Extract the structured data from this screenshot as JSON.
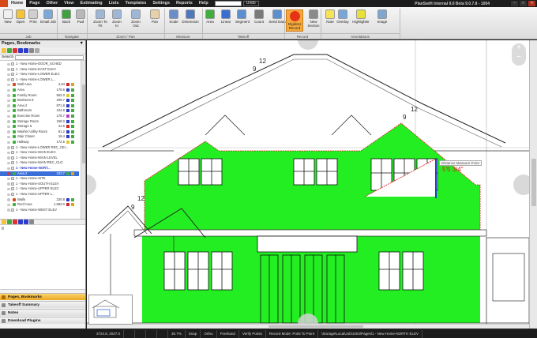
{
  "app": {
    "title": "PlanSwift Internal 9.0 Beta  9.0.7.8 - 1004",
    "menu": [
      "Home",
      "Page",
      "Other",
      "View",
      "Estimating",
      "Lists",
      "Templates",
      "Settings",
      "Reports",
      "Help"
    ],
    "search_button": "Undo",
    "window_buttons": [
      "–",
      "□",
      "✕"
    ]
  },
  "ribbon": {
    "buttons": [
      {
        "label": "New",
        "icon": "new-page-icon",
        "color": "#f0f0f0"
      },
      {
        "label": "Open",
        "icon": "folder-open-icon",
        "color": "#f3c33b"
      },
      {
        "label": "Print",
        "icon": "print-icon",
        "color": "#cfcfcf"
      },
      {
        "label": "Email Job",
        "icon": "email-icon",
        "color": "#7aa8d8"
      },
      {
        "label": "Back",
        "icon": "back-arrow-icon",
        "color": "#3fa23f"
      },
      {
        "label": "Fwd",
        "icon": "forward-arrow-icon",
        "color": "#b8b8b8"
      },
      {
        "label": "Zoom To Fit",
        "icon": "zoom-fit-icon",
        "color": "#9fb6d6"
      },
      {
        "label": "Zoom In",
        "icon": "zoom-in-icon",
        "color": "#9fb6d6"
      },
      {
        "label": "Zoom Out",
        "icon": "zoom-out-icon",
        "color": "#9fb6d6"
      },
      {
        "label": "Pan",
        "icon": "hand-pan-icon",
        "color": "#e8d0a8"
      },
      {
        "label": "Scale",
        "icon": "scale-icon",
        "color": "#6a8fc8"
      },
      {
        "label": "Dimension",
        "icon": "dimension-icon",
        "color": "#4f78bd"
      },
      {
        "label": "Area",
        "icon": "area-icon",
        "color": "#3fae3f"
      },
      {
        "label": "Linear",
        "icon": "linear-icon",
        "color": "#3a6fd0"
      },
      {
        "label": "Segment",
        "icon": "segment-icon",
        "color": "#5b8fd0"
      },
      {
        "label": "Count",
        "icon": "count-icon",
        "color": "#7a7a7a"
      },
      {
        "label": "Send Data",
        "icon": "send-data-icon",
        "color": "#5b8fd0"
      },
      {
        "label": "Digitizer Record",
        "icon": "record-icon",
        "color": "#e63217"
      },
      {
        "label": "New Section",
        "icon": "new-section-icon",
        "color": "#8a8a8a"
      },
      {
        "label": "Note",
        "icon": "note-icon",
        "color": "#f5e35a"
      },
      {
        "label": "Overlay",
        "icon": "overlay-icon",
        "color": "#78a6d9"
      },
      {
        "label": "Highlighter",
        "icon": "highlighter-icon",
        "color": "#e8df3b"
      },
      {
        "label": "Image",
        "icon": "image-icon",
        "color": "#7fa6cf"
      }
    ],
    "groups": [
      "Job",
      "Navigate",
      "Zoom / Pan",
      "Measure",
      "Takeoff",
      "Record",
      "Annotations"
    ]
  },
  "left_panel": {
    "title": "Pages, Bookmarks",
    "search_label": "Search",
    "tree": [
      {
        "name": "1 - New Home-DOOR_SCHED",
        "value": "",
        "indent": 1,
        "type": "page"
      },
      {
        "name": "1 - New Home-EAST ELEV",
        "value": "",
        "indent": 1,
        "type": "page"
      },
      {
        "name": "1 - New Home-LOWER ELEC",
        "value": "",
        "indent": 1,
        "type": "page"
      },
      {
        "name": "1 - New Home-LOWER L...",
        "value": "",
        "indent": 1,
        "type": "page"
      },
      {
        "name": "Wall Area",
        "value": "2,94",
        "indent": 2,
        "type": "item",
        "leaf": "#d44b1f",
        "swatch": "#d32a2a",
        "swatch2": "#d5a823"
      },
      {
        "name": "Area",
        "value": "178.6",
        "indent": 2,
        "type": "item",
        "leaf": "#3fae3f",
        "swatch": "#2d3cc9",
        "swatch2": "#3fae3f"
      },
      {
        "name": "Family Room",
        "value": "552.0",
        "indent": 2,
        "type": "item",
        "leaf": "#3fae3f",
        "swatch": "#e0c92b",
        "swatch2": "#3fae3f"
      },
      {
        "name": "Bedroom 8",
        "value": "209.7",
        "indent": 2,
        "type": "item",
        "leaf": "#3fae3f",
        "swatch": "#2d3cc9",
        "swatch2": "#3fae3f"
      },
      {
        "name": "Area 2",
        "value": "871.8",
        "indent": 2,
        "type": "item",
        "leaf": "#3fae3f",
        "swatch": "#2d3cc9",
        "swatch2": "#3fae3f"
      },
      {
        "name": "Bathroom",
        "value": "104.8",
        "indent": 2,
        "type": "item",
        "leaf": "#3fae3f",
        "swatch": "#2d3cc9",
        "swatch2": "#3fae3f"
      },
      {
        "name": "Exercise Room",
        "value": "178.7",
        "indent": 2,
        "type": "item",
        "leaf": "#3fae3f",
        "swatch": "#c03bc9",
        "swatch2": "#3fae3f"
      },
      {
        "name": "Storage Room",
        "value": "158.0",
        "indent": 2,
        "type": "item",
        "leaf": "#3fae3f",
        "swatch": "#2d3cc9",
        "swatch2": "#3fae3f"
      },
      {
        "name": "Storage 6",
        "value": "41.6",
        "indent": 2,
        "type": "item",
        "leaf": "#3fae3f",
        "swatch": "#d32a2a",
        "swatch2": "#3fae3f"
      },
      {
        "name": "Washer Utility Room",
        "value": "81.2",
        "indent": 2,
        "type": "item",
        "leaf": "#3fae3f",
        "swatch": "#2d3cc9",
        "swatch2": "#3fae3f"
      },
      {
        "name": "Stair Closet",
        "value": "18.4",
        "indent": 2,
        "type": "item",
        "leaf": "#3fae3f",
        "swatch": "#2d3cc9",
        "swatch2": "#3fae3f"
      },
      {
        "name": "Hallway",
        "value": "172.5",
        "indent": 2,
        "type": "item",
        "leaf": "#3fae3f",
        "swatch": "#e0c92b",
        "swatch2": "#3fae3f"
      },
      {
        "name": "1 - New Home-LOWER REC_CEI...",
        "value": "",
        "indent": 1,
        "type": "page"
      },
      {
        "name": "1 - New Home-MAIN ELEC",
        "value": "",
        "indent": 1,
        "type": "page"
      },
      {
        "name": "1 - New Home-MAIN LEVEL",
        "value": "",
        "indent": 1,
        "type": "page"
      },
      {
        "name": "1 - New Home-MAIN REC_CLG",
        "value": "",
        "indent": 1,
        "type": "page"
      },
      {
        "name": "1 - New Home-NORT...",
        "value": "",
        "indent": 1,
        "type": "page",
        "bold": true
      },
      {
        "name": "Area 2",
        "value": "323.7",
        "indent": 2,
        "type": "item",
        "leaf": "#3fae3f",
        "swatch": "#3fae3f",
        "swatch2": "#d5a823",
        "selected": true
      },
      {
        "name": "1 - New Home-SITE",
        "value": "",
        "indent": 1,
        "type": "page"
      },
      {
        "name": "1 - New Home-SOUTH ELEV",
        "value": "",
        "indent": 1,
        "type": "page"
      },
      {
        "name": "1 - New Home-UPPER ELEC",
        "value": "",
        "indent": 1,
        "type": "page"
      },
      {
        "name": "1 - New Home-UPPER L...",
        "value": "",
        "indent": 1,
        "type": "page"
      },
      {
        "name": "Walls",
        "value": "220.8",
        "indent": 2,
        "type": "item",
        "leaf": "#d44b1f",
        "swatch": "#2d3cc9",
        "swatch2": "#3fae3f"
      },
      {
        "name": "Roof Area",
        "value": "1,963.0",
        "indent": 2,
        "type": "item",
        "leaf": "#3fae3f",
        "swatch": "#d32a2a",
        "swatch2": "#d5a823"
      },
      {
        "name": "1 - New Home-WEST ELEV",
        "value": "",
        "indent": 1,
        "type": "page"
      }
    ],
    "accordion": [
      {
        "label": "Pages, Bookmarks",
        "active": true
      },
      {
        "label": "Takeoff Summary",
        "active": false
      },
      {
        "label": "Notes",
        "active": false
      },
      {
        "label": "Download Plugins",
        "active": false
      }
    ]
  },
  "canvas": {
    "measurement_label": "Distance Measure Point",
    "measurement_value": "5'5 3/4\"",
    "roof_pitch_labels": [
      "9",
      "12",
      "9",
      "12",
      "9",
      "12"
    ],
    "highlight_color": "#22ee22",
    "measure_color": "#e02020"
  },
  "status": {
    "cells": [
      "3724.8, 2027.0",
      "",
      "",
      "",
      "",
      "30.7%",
      "Snap",
      "Ortho",
      "Freehand",
      "Verify Points",
      "Record Mode: Point To Point",
      "\\Storage\\Local\\Job\\1004\\Pages\\1 - New Home-NORTH ELEV"
    ]
  }
}
